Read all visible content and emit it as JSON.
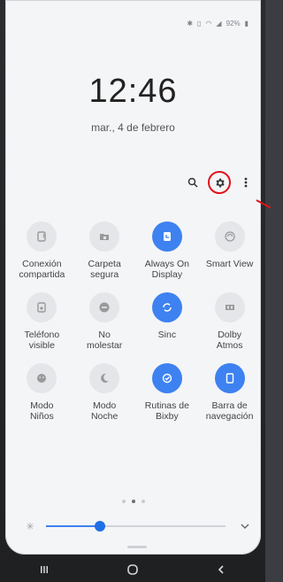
{
  "status_bar": {
    "battery_text": "92%",
    "icons": [
      "bluetooth-icon",
      "vibrate-icon",
      "wifi-icon",
      "signal-icon",
      "battery-icon"
    ]
  },
  "lock": {
    "time": "12:46",
    "date": "mar., 4 de febrero"
  },
  "toolbar": {
    "icons": [
      "search-icon",
      "gear-icon",
      "more-icon"
    ]
  },
  "quick_settings": {
    "tiles": [
      {
        "label": "Conexión\ncompartida",
        "icon": "hotspot-icon",
        "active": false
      },
      {
        "label": "Carpeta\nsegura",
        "icon": "secure-folder-icon",
        "active": false
      },
      {
        "label": "Always On\nDisplay",
        "icon": "always-on-display-icon",
        "active": true
      },
      {
        "label": "Smart View",
        "icon": "smart-view-icon",
        "active": false
      },
      {
        "label": "Teléfono\nvisible",
        "icon": "phone-visible-icon",
        "active": false
      },
      {
        "label": "No\nmolestar",
        "icon": "do-not-disturb-icon",
        "active": false
      },
      {
        "label": "Sinc",
        "icon": "sync-icon",
        "active": true
      },
      {
        "label": "Dolby\nAtmos",
        "icon": "dolby-icon",
        "active": false
      },
      {
        "label": "Modo\nNiños",
        "icon": "kids-mode-icon",
        "active": false
      },
      {
        "label": "Modo\nNoche",
        "icon": "night-mode-icon",
        "active": false
      },
      {
        "label": "Rutinas de\nBixby",
        "icon": "bixby-routines-icon",
        "active": true
      },
      {
        "label": "Barra de\nnavegación",
        "icon": "navigation-bar-icon",
        "active": true
      }
    ]
  },
  "pager": {
    "count": 3,
    "active": 1
  },
  "brightness": {
    "level": 0.3
  },
  "nav_bar": {
    "buttons": [
      "recents",
      "home",
      "back"
    ]
  },
  "colors": {
    "accent": "#3d82f0",
    "highlight": "#e0121a"
  }
}
